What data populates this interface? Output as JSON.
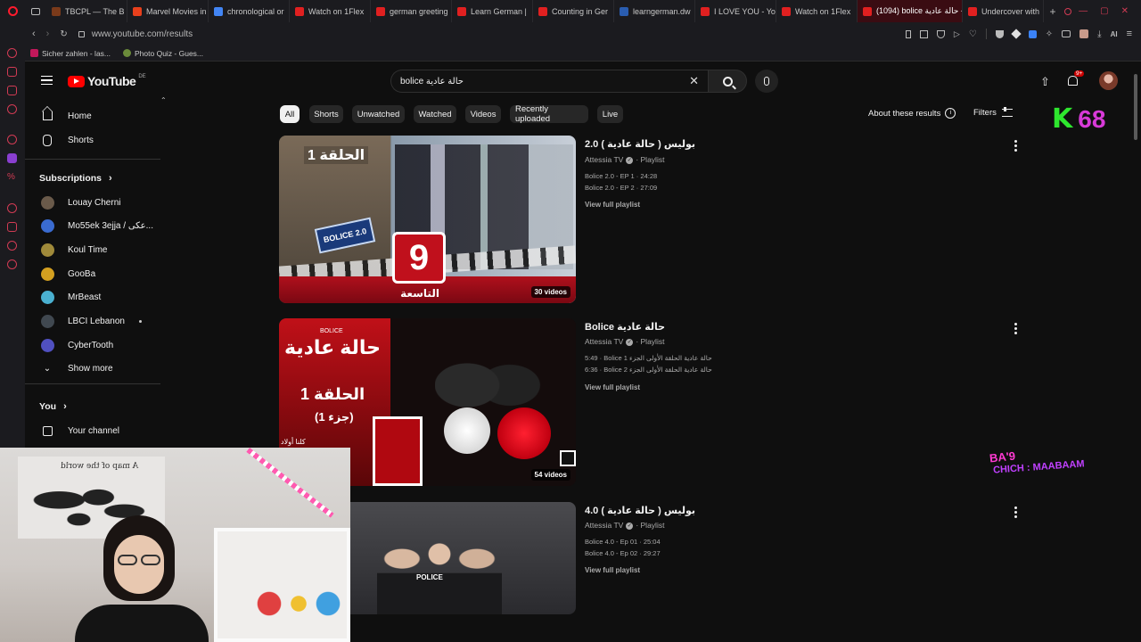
{
  "browser": {
    "tabs": [
      {
        "label": "TBCPL — The B",
        "color": "#7a3a1a"
      },
      {
        "label": "Marvel Movies in",
        "color": "#e8401c"
      },
      {
        "label": "chronological or",
        "color": "#4285f4"
      },
      {
        "label": "Watch on 1Flex",
        "color": "#e02020"
      },
      {
        "label": "german greeting",
        "color": "#e02020"
      },
      {
        "label": "Learn German |",
        "color": "#e02020"
      },
      {
        "label": "Counting in Ger",
        "color": "#e02020"
      },
      {
        "label": "learngerman.dw",
        "color": "#2a5db0"
      },
      {
        "label": "I LOVE YOU - Yo",
        "color": "#e02020"
      },
      {
        "label": "Watch on 1Flex",
        "color": "#e02020"
      },
      {
        "label": "(1094) bolice حالة عادية - Yo",
        "color": "#e02020"
      },
      {
        "label": "Undercover with",
        "color": "#e02020"
      }
    ],
    "url": "www.youtube.com/results",
    "bookmarks": [
      "Sicher zahlen - las...",
      "Photo Quiz - Gues..."
    ]
  },
  "youtube": {
    "logo": "YouTube",
    "country": "DE",
    "search": {
      "value": "bolice حالة عادية"
    },
    "notif_count": "9+",
    "sidebar": {
      "home": "Home",
      "shorts": "Shorts",
      "subscriptions_label": "Subscriptions",
      "subscriptions": [
        {
          "label": "Louay Cherni",
          "color": "#6a5a4a",
          "dot": false
        },
        {
          "label": "Mo55ek 3ejja / عكى...",
          "color": "#3a6bd0",
          "dot": false
        },
        {
          "label": "Koul Time",
          "color": "#a08a3a",
          "dot": false
        },
        {
          "label": "GooBa",
          "color": "#d4a020",
          "dot": false
        },
        {
          "label": "MrBeast",
          "color": "#4ab0d0",
          "dot": false
        },
        {
          "label": "LBCI Lebanon",
          "color": "#404850",
          "dot": true
        },
        {
          "label": "CyberTooth",
          "color": "#5050c0",
          "dot": false
        }
      ],
      "show_more": "Show more",
      "you_label": "You",
      "your_channel": "Your channel"
    },
    "chips": [
      "All",
      "Shorts",
      "Unwatched",
      "Watched",
      "Videos",
      "Recently uploaded",
      "Live"
    ],
    "about_results": "About these results",
    "filters": "Filters",
    "results": [
      {
        "title": "بوليس ( حالة عادية ) 2.0",
        "channel": "Attessia TV",
        "type": "Playlist",
        "entries": [
          "Bolice 2.0 - EP 1 · 24:28",
          "Bolice 2.0 - EP 2 · 27:09"
        ],
        "full": "View full playlist",
        "count": "30 videos",
        "thumb_text": "الحلقة 1",
        "logo_num": "9",
        "logo_text": "التاسعة",
        "banner": "BOLICE 2.0"
      },
      {
        "title": "Bolice حالة عادية",
        "channel": "Attessia TV",
        "type": "Playlist",
        "entries": [
          "5:49 · Bolice حالة عادية الحلقة الأولى الجزء 1",
          "6:36 · Bolice حالة عادية الحلقة الأولى الجزء 2"
        ],
        "full": "View full playlist",
        "count": "54 videos",
        "thumb_small": "BOLICE",
        "thumb_text": "حالة عادية",
        "thumb_ep": "الحلقة 1",
        "thumb_part": "(جزء 1)",
        "thumb_caption": "كلنا أولاد"
      },
      {
        "title": "بوليس ( حالة عادية ) 4.0",
        "channel": "Attessia TV",
        "type": "Playlist",
        "entries": [
          "Bolice 4.0 - Ep 01 · 25:04",
          "Bolice 4.0 - Ep 02 · 29:27"
        ],
        "full": "View full playlist",
        "thumb_text": "POLICE"
      }
    ]
  },
  "overlays": {
    "k_logo": "K",
    "k_number": "68",
    "sticker_line1": "BA'9",
    "sticker_line2": "CHICH : MAABAAM",
    "webcam_poster": "A map of the world"
  }
}
